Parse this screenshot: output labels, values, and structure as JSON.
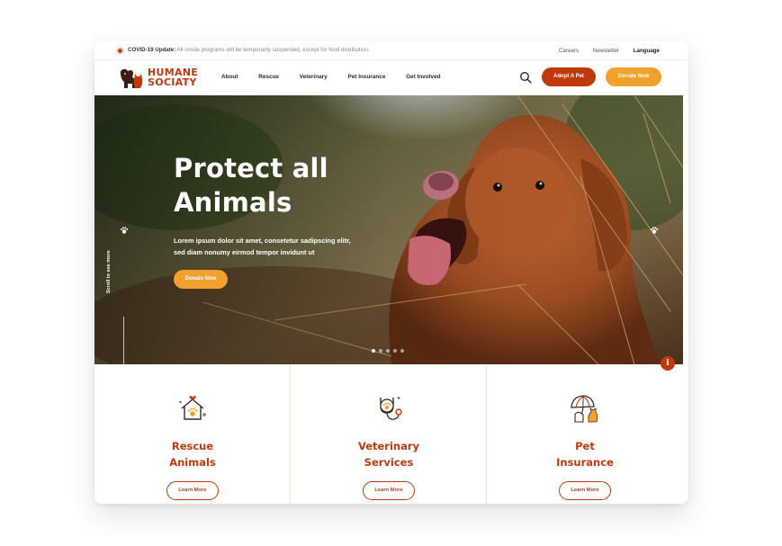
{
  "notice": {
    "headline": "COVID-19 Update:",
    "message": " All onsite programs will be temporarily suspended, except for food distribution."
  },
  "top_links": [
    "Careers",
    "Newsletter",
    "Language"
  ],
  "brand": {
    "line1": "HUMANE",
    "line2": "SOCIATY"
  },
  "nav": [
    "About",
    "Rescue",
    "Veterinary",
    "Pet Insurance",
    "Get Involved"
  ],
  "header_buttons": {
    "adopt": "Adopt A Pet",
    "donate": "Donate Now"
  },
  "hero": {
    "title_line1": "Protect all",
    "title_line2": "Animals",
    "subtitle": "Lorem ipsum dolor sit amet, consetetur sadipscing elitr, sed diam nonumy eirmod tempor invidunt ut",
    "cta": "Donate Now",
    "scroll_hint": "Scroll to see more",
    "slides": 5,
    "active_slide": 1
  },
  "info_button": "i",
  "cards": [
    {
      "title_line1": "Rescue",
      "title_line2": "Animals",
      "button": "Learn More",
      "icon": "paw-house-icon"
    },
    {
      "title_line1": "Veterinary",
      "title_line2": "Services",
      "button": "Learn More",
      "icon": "stethoscope-paw-icon"
    },
    {
      "title_line1": "Pet",
      "title_line2": "Insurance",
      "button": "Learn More",
      "icon": "umbrella-pets-icon"
    }
  ],
  "colors": {
    "brand": "#c0390c",
    "accent": "#f1a12c",
    "text": "#2b2b2b"
  }
}
